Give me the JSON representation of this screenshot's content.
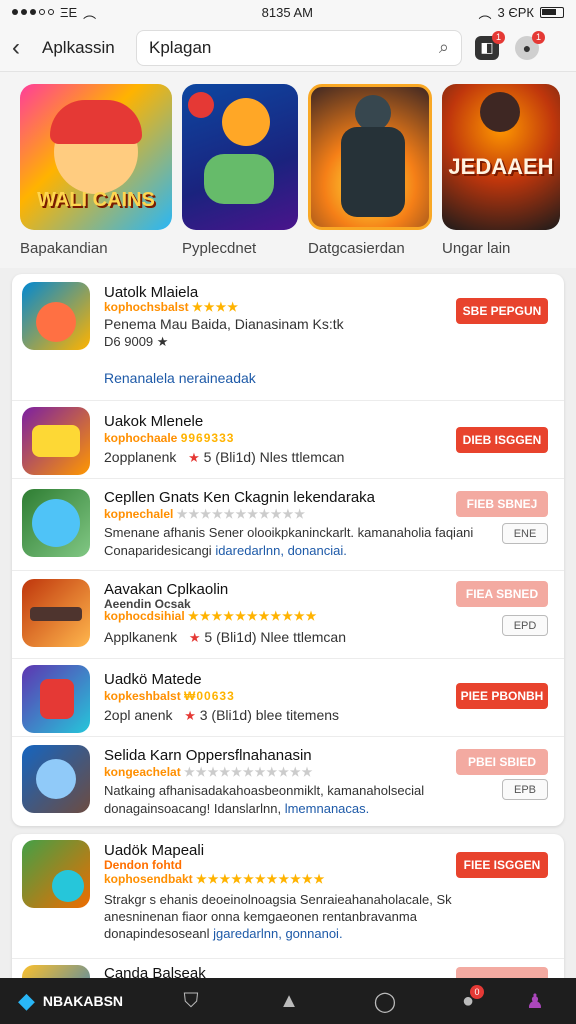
{
  "status_bar": {
    "carrier": "ΞΕ",
    "time": "8135 AM",
    "battery_text": "3 ЄРК"
  },
  "header": {
    "title": "Aplkassin",
    "search_value": "Kplagan",
    "notif_badge": "1",
    "profile_badge": "1"
  },
  "featured": [
    {
      "caption": "Bapakandian",
      "art_text": "WALI CAINS"
    },
    {
      "caption": "Pyplecdnet",
      "art_text": ""
    },
    {
      "caption": "Datgcasierdan",
      "art_text": ""
    },
    {
      "caption": "Ungar lain",
      "art_text": "JEDAAEH"
    }
  ],
  "list": [
    {
      "title": "Uatolk Mlaiela",
      "sub": "kophochsbalst",
      "stars": "★★★★",
      "line1": "Penema Mau Baida, Dianasinam Ks:tk",
      "line2": "D6 9009 ★",
      "link": "Renanalela neraineadak",
      "button": "SBE PEPGUN",
      "faded": false
    },
    {
      "title": "Uakok Mlenele",
      "sub": "kophochaale",
      "stars": "9969333",
      "line1": "2opplanenk",
      "line1b": "5 (Bli1d) Nles ttlemcan",
      "button": "DIEB ISGGEN",
      "faded": false
    },
    {
      "title": "Cepllen Gnats Ken Ckagnin lekendaraka",
      "sub": "kopnechalel",
      "stars": "★★★★★★★★★★★",
      "line1": "Smenane afhanis Sener olooikpkaninckarlt. kamanaholia faqiani",
      "link_prefix": "Conaparidesicangi",
      "link": "idaredarlnn, donanciai.",
      "button": "FIEB SBNEJ",
      "faded": true,
      "button2": "ENE"
    },
    {
      "title": "Aavakan Cplkaolin",
      "sub2": "Aeendin Ocsak",
      "sub": "kophocdsihial",
      "stars": "★★★★★★★★★★★",
      "line1": "Applkanenk",
      "line1b": "5 (Bli1d) Nlee ttlemcan",
      "button": "FIEA SBNED",
      "faded": true,
      "button2": "EPD"
    },
    {
      "title": "Uadkö Matede",
      "sub": "kopkeshbalst",
      "stars": "₩00633",
      "line1": "2opl anenk",
      "line1b": "3 (Bli1d) blee titemens",
      "button": "PIEE PBONBH",
      "faded": false
    },
    {
      "title": "Selida Karn Oppersflnahanasin",
      "sub": "kongeachelat",
      "stars": "★★★★★★★★★★★",
      "line1": "Natkaing afhanisadakahoasbeonmiklt, kamanaholsecial",
      "link_prefix": "donagainsoacang! Idanslarlnn,",
      "link": "lmemnanacas.",
      "button": "PBEI SBIED",
      "faded": true,
      "button2": "EPB"
    }
  ],
  "list2": [
    {
      "title": "Uadök Mapeali",
      "sub2": "Dendon fohtd",
      "sub": "kophosendbakt",
      "stars": "★★★★★★★★★★★",
      "line1": "Strakgr s ehanis deoeinolnoagsia Senraieahanaholacale, Sk",
      "line1c": "anesninenan fiaor onna kemgaeonen rentanbravanma",
      "link_prefix": "donapindesoseanl",
      "link": "jgaredarlnn, gonnanoi.",
      "button": "FIEE ISGGEN",
      "faded": false
    },
    {
      "title": "Canda Balseak",
      "button": "",
      "faded": true
    }
  ],
  "bottom_nav": {
    "home_label": "NBAKABSN",
    "chat_badge": "0"
  },
  "colors": {
    "accent": "#e8432d",
    "link": "#1e5aa8",
    "nav_bg": "#1e1e1e"
  }
}
